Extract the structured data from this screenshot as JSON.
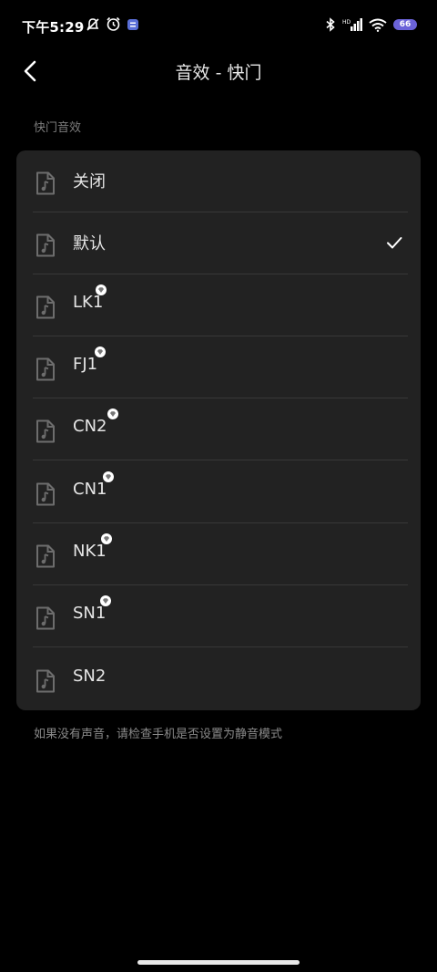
{
  "status_bar": {
    "time": "下午5:29",
    "battery": "66"
  },
  "header": {
    "title": "音效 - 快门"
  },
  "section_label": "快门音效",
  "options": [
    {
      "label": "关闭",
      "premium": false,
      "selected": false
    },
    {
      "label": "默认",
      "premium": false,
      "selected": true
    },
    {
      "label": "LK1",
      "premium": true,
      "selected": false
    },
    {
      "label": "FJ1",
      "premium": true,
      "selected": false
    },
    {
      "label": "CN2",
      "premium": true,
      "selected": false
    },
    {
      "label": "CN1",
      "premium": true,
      "selected": false
    },
    {
      "label": "NK1",
      "premium": true,
      "selected": false
    },
    {
      "label": "SN1",
      "premium": true,
      "selected": false
    },
    {
      "label": "SN2",
      "premium": false,
      "selected": false
    }
  ],
  "footer_note": "如果没有声音，请检查手机是否设置为静音模式",
  "colors": {
    "background": "#000000",
    "card": "#222222",
    "battery": "#6b63d9"
  }
}
